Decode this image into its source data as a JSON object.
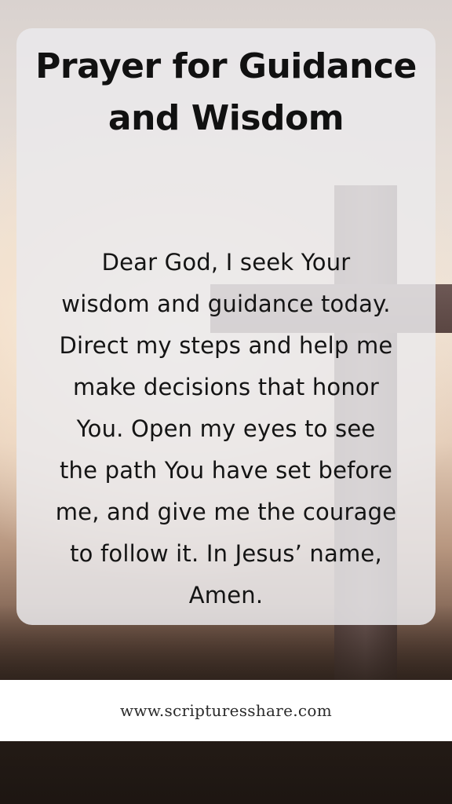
{
  "title_line_1": "Prayer for Guidance",
  "title_line_2": "and Wisdom",
  "prayer_lines": [
    "Dear God, I seek Your",
    "wisdom and guidance today.",
    "Direct my steps and help me",
    "make decisions that honor",
    "You. Open my eyes to see",
    "the path You have set before",
    "me, and give me the courage",
    "to follow it. In Jesus’ name,",
    "Amen."
  ],
  "footer_url": "www.scripturesshare.com"
}
